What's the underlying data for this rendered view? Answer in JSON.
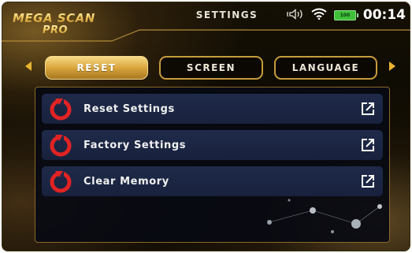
{
  "app": {
    "logo_line1": "MEGA SCAN",
    "logo_line2": "PRO",
    "title": "SETTINGS"
  },
  "status_bar": {
    "volume_icon": "speaker-icon",
    "wifi_icon": "wifi-icon",
    "battery_icon": "battery-icon",
    "battery_level": "100",
    "time": "00:14",
    "battery_color": "#3fbf3a"
  },
  "tabs": [
    {
      "label": "RESET",
      "active": true
    },
    {
      "label": "SCREEN",
      "active": false
    },
    {
      "label": "LANGUAGE",
      "active": false
    }
  ],
  "menu": {
    "items": [
      {
        "label": "Reset Settings",
        "icon": "reset-icon",
        "action_icon": "open-external-icon"
      },
      {
        "label": "Factory Settings",
        "icon": "reset-icon",
        "action_icon": "open-external-icon"
      },
      {
        "label": "Clear Memory",
        "icon": "reset-icon",
        "action_icon": "open-external-icon"
      }
    ]
  },
  "colors": {
    "accent_gold": "#d9a63e",
    "row_background": "#1f2a4a",
    "icon_red": "#e12323"
  }
}
